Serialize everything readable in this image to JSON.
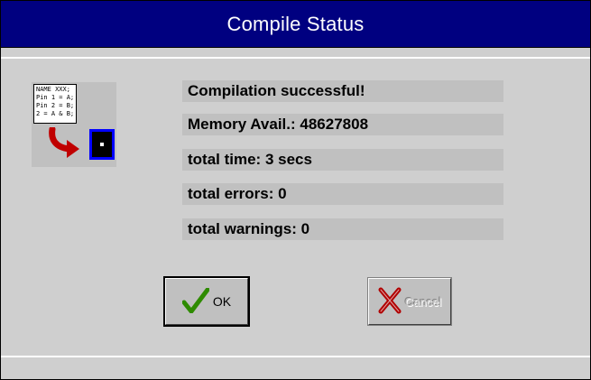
{
  "window": {
    "title": "Compile Status"
  },
  "icon": {
    "code_lines": [
      "NAME XXX;",
      "Pin 1 = A;",
      "Pin 2 = B;",
      "2 = A & B;"
    ]
  },
  "status": {
    "line1": "Compilation successful!",
    "line2": "Memory Avail.: 48627808",
    "line3": "total time: 3 secs",
    "line4": "total errors: 0",
    "line5": "total warnings: 0"
  },
  "buttons": {
    "ok_label": "OK",
    "cancel_label": "Cancel",
    "cancel_enabled": false
  },
  "colors": {
    "titlebar": "#000080",
    "arrow": "#c00000",
    "chip_frame": "#0000ff",
    "ok_check": "#2e8b00",
    "cancel_x": "#b00000"
  }
}
